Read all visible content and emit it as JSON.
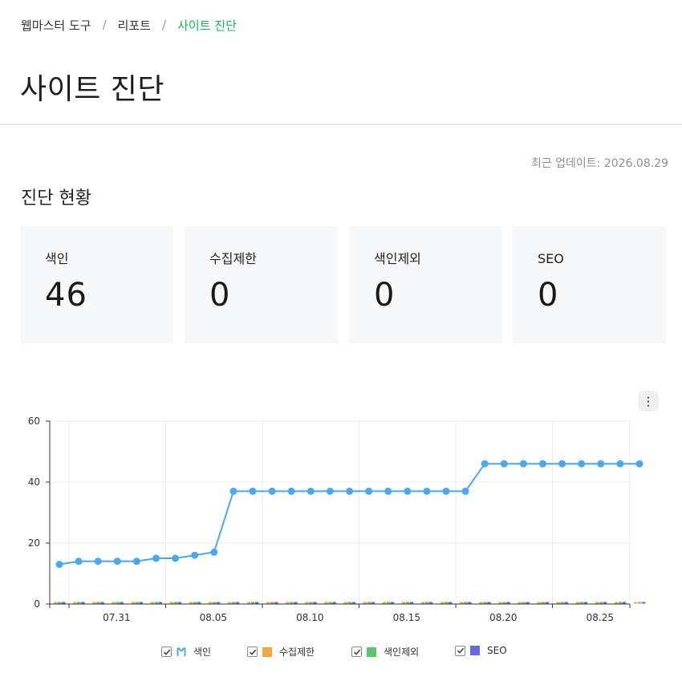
{
  "breadcrumb": {
    "items": [
      "웹마스터 도구",
      "리포트"
    ],
    "separator": "/",
    "current": "사이트 진단"
  },
  "page_title": "사이트 진단",
  "last_update": "최근 업데이트: 2026.08.29",
  "section_title": "진단 현황",
  "cards": [
    {
      "label": "색인",
      "value": "46"
    },
    {
      "label": "수집제한",
      "value": "0"
    },
    {
      "label": "색인제외",
      "value": "0"
    },
    {
      "label": "SEO",
      "value": "0"
    }
  ],
  "more_button_icon": "more-vertical-icon",
  "legend": {
    "items": [
      {
        "label": "색인",
        "checked": true,
        "swatch": "line"
      },
      {
        "label": "수집제한",
        "checked": true,
        "swatch": "square"
      },
      {
        "label": "색인제외",
        "checked": true,
        "swatch": "square"
      },
      {
        "label": "SEO",
        "checked": true,
        "swatch": "square"
      }
    ]
  },
  "chart_data": {
    "type": "line",
    "x_start": "2026-07-28",
    "x": [
      "07.28",
      "07.29",
      "07.30",
      "07.31",
      "08.01",
      "08.02",
      "08.03",
      "08.04",
      "08.05",
      "08.06",
      "08.07",
      "08.08",
      "08.09",
      "08.10",
      "08.11",
      "08.12",
      "08.13",
      "08.14",
      "08.15",
      "08.16",
      "08.17",
      "08.18",
      "08.19",
      "08.20",
      "08.21",
      "08.22",
      "08.23",
      "08.24",
      "08.25",
      "08.26",
      "08.27"
    ],
    "x_tick_labels": [
      "07.31",
      "08.05",
      "08.10",
      "08.15",
      "08.20",
      "08.25"
    ],
    "ylim": [
      0,
      60
    ],
    "y_ticks": [
      0,
      20,
      40,
      60
    ],
    "grid": true,
    "legend_position": "bottom",
    "series": [
      {
        "name": "색인",
        "render": "line",
        "color": "#4aa8f0",
        "values": [
          13,
          14,
          14,
          14,
          14,
          15,
          15,
          16,
          17,
          37,
          37,
          37,
          37,
          37,
          37,
          37,
          37,
          37,
          37,
          37,
          37,
          37,
          46,
          46,
          46,
          46,
          46,
          46,
          46,
          46,
          46
        ]
      },
      {
        "name": "수집제한",
        "render": "bar",
        "color": "#f5a742",
        "values": [
          0,
          0,
          0,
          0,
          0,
          0,
          0,
          0,
          0,
          0,
          0,
          0,
          0,
          0,
          0,
          0,
          0,
          0,
          0,
          0,
          0,
          0,
          0,
          0,
          0,
          0,
          0,
          0,
          0,
          0,
          0
        ]
      },
      {
        "name": "색인제외",
        "render": "bar",
        "color": "#57c76f",
        "values": [
          0,
          0,
          0,
          0,
          0,
          0,
          0,
          0,
          0,
          0,
          0,
          0,
          0,
          0,
          0,
          0,
          0,
          0,
          0,
          0,
          0,
          0,
          0,
          0,
          0,
          0,
          0,
          0,
          0,
          0,
          0
        ]
      },
      {
        "name": "SEO",
        "render": "bar",
        "color": "#6b66e8",
        "values": [
          0,
          0,
          0,
          0,
          0,
          0,
          0,
          0,
          0,
          0,
          0,
          0,
          0,
          0,
          0,
          0,
          0,
          0,
          0,
          0,
          0,
          0,
          0,
          0,
          0,
          0,
          0,
          0,
          0,
          0,
          0
        ]
      }
    ]
  }
}
